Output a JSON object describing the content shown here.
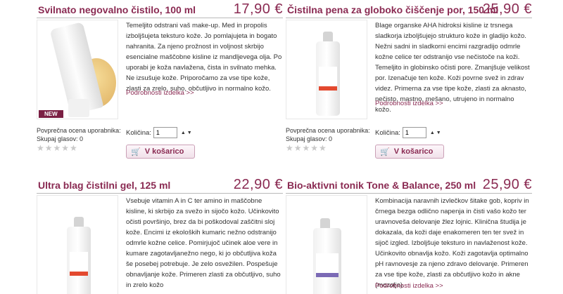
{
  "products": [
    {
      "title": "Svilnato negovalno čistilo, 100 ml",
      "price": "17,90 €",
      "badge": "NEW",
      "description": "Temeljito odstrani vaš make-up. Med in propolis izboljšujeta teksturo kože. Jo pomlajujeta in bogato nahranita. Za njeno prožnost in voljnost skrbijo esencialne maščobne kisline iz mandljevega olja. Po uporabi je koža navlažena, čista in svilnato mehka. Ne izsušuje kože. Priporočamo za vse tipe kože, zlasti za zrelo, suho, občutljivo in normalno kožo.",
      "more_link": "Podrobnosti izdelka >>",
      "rating_label": "Povprečna ocena uporabnika:",
      "votes_label": "Skupaj glasov: 0",
      "stars": "★★★★★",
      "qty_label": "Količina:",
      "qty_value": "1",
      "cart_label": "V košarico"
    },
    {
      "title": "Čistilna pena za globoko čiščenje por, 150 ml",
      "price": "25,90 €",
      "description": "Blage organske AHA hidroksi kisline iz trsnega sladkorja izboljšujejo strukturo kože in gladijo kožo. Nežni sadni in sladkorni encimi razgradijo odmrle kožne celice ter odstranijo vse nečistoče na koži. Temeljito in globinsko očisti pore. Zmanjšuje velikost por. Izenačuje ten kože. Koži povrne svež in zdrav videz. Primerna za vse tipe kože, zlasti za aknasto, nečisto, mastno, mešano, utrujeno in normalno kožo.",
      "more_link": "Podrobnosti izdelka >>",
      "rating_label": "Povprečna ocena uporabnika:",
      "votes_label": "Skupaj glasov: 0",
      "stars": "★★★★★",
      "qty_label": "Količina:",
      "qty_value": "1",
      "cart_label": "V košarico"
    },
    {
      "title": "Ultra blag čistilni gel, 125 ml",
      "price": "22,90 €",
      "description": "Vsebuje vitamin A in C ter amino in maščobne kisline, ki skrbijo za svežo in sijočo kožo. Učinkovito očisti površinjo, brez da bi poškodoval zaščitni sloj kože. Encimi iz ekoloških kumaric nežno odstranijo odmrle kožne celice. Pomirjujoč učinek aloe vere in kumare zagotavljanežno nego, ki jo občutljiva koža še posebej potrebuje. Je zelo osvežilen. Pospešuje obnavljanje kože. Primeren zlasti za občutljivo, suho in zrelo kožo"
    },
    {
      "title": "Bio-aktivni tonik Tone & Balance, 250 ml",
      "price": "25,90 €",
      "description": "Kombinacija naravnih izvlečkov šitake gob, kopriv in črnega bezga odlično napenja in čisti vašo kožo ter uravnoveša delovanje žlez lojnic. Klinična študija je dokazala, da koži daje enakomeren ten ter svež in sijoč izgled. Izboljšuje teksturo in navlaženost kože. Učinkovito obnavlja kožo. Koži zagotavlja optimalno pH ravnovesje za njeno zdravo delovanje. Primeren za vse tipe kože, zlasti za občutljivo kožo in akne (mozolje).",
      "more_link": "Podrobnosti izdelka >>"
    }
  ],
  "colors": {
    "accent": "#8a2a52",
    "badge": "#7a1f43"
  }
}
